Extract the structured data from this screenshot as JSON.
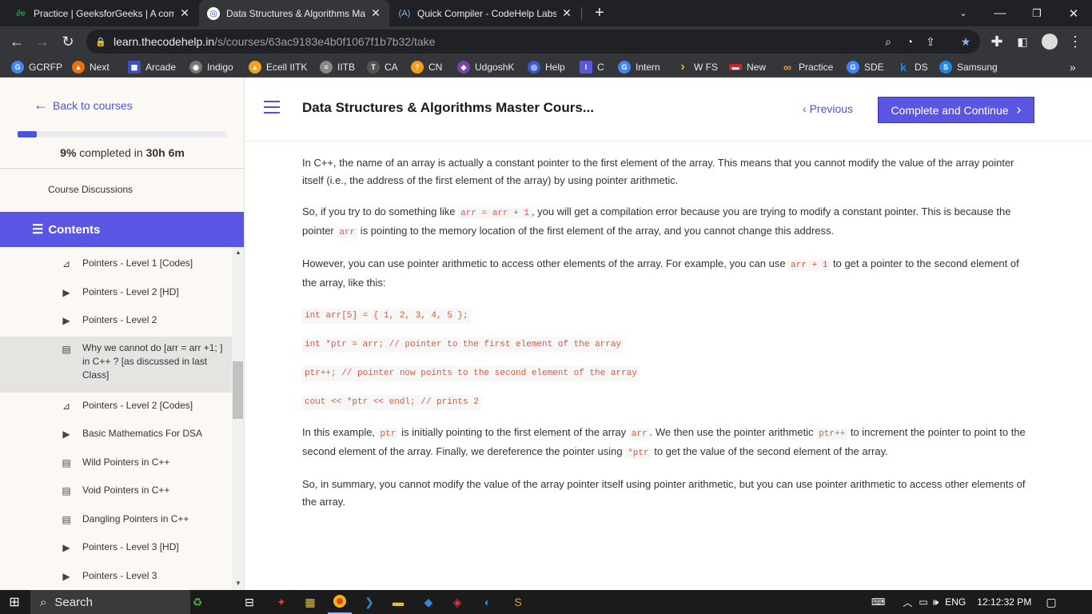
{
  "browser": {
    "tabs": [
      {
        "title": "Practice | GeeksforGeeks | A comp",
        "icon": "gfg-icon",
        "active": false
      },
      {
        "title": "Data Structures & Algorithms Ma",
        "icon": "codehelp-icon",
        "active": true
      },
      {
        "title": "Quick Compiler - CodeHelp Labs",
        "icon": "codehelp-labs-icon",
        "active": false
      }
    ],
    "new_tab": "+",
    "url_host": "learn.thecodehelp.in",
    "url_path": "/s/courses/63ac9183e4b0f1067f1b7b32/take",
    "bookmarks": [
      {
        "label": "GCRFP",
        "color": "#4285f4",
        "glyph": "G"
      },
      {
        "label": "Next",
        "color": "#e8710a",
        "glyph": "▲"
      },
      {
        "label": "Arcade",
        "color": "#3f51b5",
        "glyph": "▦"
      },
      {
        "label": "Indigo",
        "color": "#777",
        "glyph": "◉"
      },
      {
        "label": "Ecell IITK",
        "color": "#f4a31b",
        "glyph": "▲"
      },
      {
        "label": "IITB",
        "color": "#888",
        "glyph": "≡"
      },
      {
        "label": "CA",
        "color": "#555",
        "glyph": "T"
      },
      {
        "label": "CN",
        "color": "#f29d1a",
        "glyph": "?"
      },
      {
        "label": "UdgoshK",
        "color": "#7b3fb0",
        "glyph": "◆"
      },
      {
        "label": "Help",
        "color": "#3a59d1",
        "glyph": "◎"
      },
      {
        "label": "C",
        "color": "#5b55e3",
        "glyph": "I"
      },
      {
        "label": "Intern",
        "color": "#4285f4",
        "glyph": "G"
      },
      {
        "label": "W FS",
        "color": "#f5b400",
        "glyph": "›"
      },
      {
        "label": "New",
        "color": "#c62828",
        "glyph": "▬"
      },
      {
        "label": "Practice",
        "color": "#f29d1a",
        "glyph": "∞"
      },
      {
        "label": "SDE",
        "color": "#4285f4",
        "glyph": "G"
      },
      {
        "label": "DS",
        "color": "#1e88e5",
        "glyph": "k"
      },
      {
        "label": "Samsung",
        "color": "#1e88e5",
        "glyph": "S"
      }
    ],
    "more": "»"
  },
  "sidebar": {
    "back_label": "Back to courses",
    "progress_fraction": 0.09,
    "progress_pct": "9%",
    "progress_mid": " completed in ",
    "progress_time": "30h 6m",
    "discussions": "Course Discussions",
    "contents_label": "Contents",
    "lessons": [
      {
        "label": "Pointers - Level 1 [Codes]",
        "icon": "code-icon",
        "active": false
      },
      {
        "label": "Pointers - Level 2 [HD]",
        "icon": "video-icon",
        "active": false
      },
      {
        "label": "Pointers - Level 2",
        "icon": "video-icon",
        "active": false
      },
      {
        "label": "Why we cannot do [arr = arr +1; ] in C++ ? [as discussed in last Class]",
        "icon": "document-icon",
        "active": true
      },
      {
        "label": "Pointers - Level 2 [Codes]",
        "icon": "code-icon",
        "active": false
      },
      {
        "label": "Basic Mathematics For DSA",
        "icon": "video-icon",
        "active": false
      },
      {
        "label": "Wild Pointers in C++",
        "icon": "document-icon",
        "active": false
      },
      {
        "label": "Void Pointers in C++",
        "icon": "document-icon",
        "active": false
      },
      {
        "label": "Dangling Pointers in C++",
        "icon": "document-icon",
        "active": false
      },
      {
        "label": "Pointers - Level 3 [HD]",
        "icon": "video-icon",
        "active": false
      },
      {
        "label": "Pointers - Level 3",
        "icon": "video-icon",
        "active": false
      }
    ]
  },
  "header": {
    "course_title": "Data Structures & Algorithms Master Cours...",
    "previous_label": "Previous",
    "complete_label": "Complete and Continue"
  },
  "article": {
    "p1": "In C++, the name of an array is actually a constant pointer to the first element of the array. This means that you cannot modify the value of the array pointer itself (i.e., the address of the first element of the array) by using pointer arithmetic.",
    "p2a": "So, if you try to do something like ",
    "p2code1": "arr = arr + 1",
    "p2b": ", you will get a compilation error because you are trying to modify a constant pointer. This is because the pointer ",
    "p2code2": "arr",
    "p2c": " is pointing to the memory location of the first element of the array, and you cannot change this address.",
    "p3a": "However, you can use pointer arithmetic to access other elements of the array. For example, you can use ",
    "p3code": "arr + 1",
    "p3b": " to get a pointer to the second element of the array, like this:",
    "code1": "int arr[5] = { 1, 2, 3, 4, 5 };",
    "code2": "int *ptr = arr; // pointer to the first element of the array",
    "code3": "ptr++; // pointer now points to the second element of the array",
    "code4": "cout << *ptr << endl; // prints 2",
    "p4a": "In this example, ",
    "p4code1": "ptr",
    "p4b": " is initially pointing to the first element of the array ",
    "p4code2": "arr",
    "p4c": ". We then use the pointer arithmetic ",
    "p4code3": "ptr++",
    "p4d": " to increment the pointer to point to the second element of the array. Finally, we dereference the pointer using ",
    "p4code4": "*ptr",
    "p4e": " to get the value of the second element of the array.",
    "p5": "So, in summary, you cannot modify the value of the array pointer itself using pointer arithmetic, but you can use pointer arithmetic to access other elements of the array."
  },
  "taskbar": {
    "search_label": "Search",
    "lang": "ENG",
    "time": "12:12:32 PM"
  }
}
